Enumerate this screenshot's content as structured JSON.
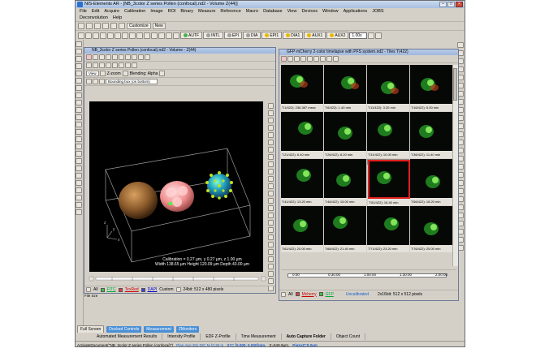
{
  "app": {
    "title": "NIS-Elements AR - [NB_3color Z series Pollen (confocal).nd2 - Volume   Z(44)]"
  },
  "menu": [
    "File",
    "Edit",
    "Acquire",
    "Calibration",
    "Image",
    "ROI",
    "Binary",
    "Measure",
    "Reference",
    "Macro",
    "Database",
    "View",
    "Devices",
    "Window",
    "Applications",
    "JOBS"
  ],
  "menu2": [
    "Deconvolution",
    "Help"
  ],
  "toolbar1": {
    "customize": "Customize",
    "new": "New"
  },
  "toolbar2": {
    "channels": [
      {
        "label": "AUTF",
        "color": "#4caf50"
      },
      {
        "label": "INTL",
        "color": "#9e9e9e"
      },
      {
        "label": "EPI",
        "color": "#9e9e9e"
      },
      {
        "label": "DIA",
        "color": "#9e9e9e"
      },
      {
        "label": "EPI1",
        "color": "#e6b800"
      },
      {
        "label": "DIA1",
        "color": "#e6b800"
      },
      {
        "label": "AUX1",
        "color": "#e6b800"
      },
      {
        "label": "AUX2",
        "color": "#e6b800"
      }
    ],
    "zoom": "1.00x"
  },
  "left_doc": {
    "title": "NB_3color Z series Pollen (confocal).nd2 - Volume - Z(44)",
    "view_label": "View",
    "z_zoom": "Z-zoom",
    "blending_label": "Blending: Alpha",
    "bbox": "Bounding box (on bottom)",
    "calibration_line1": "Calibration = 0.27 µm, y 0.27 µm, z 1.00 µm",
    "calibration_line2": "Width 138.65 µm Height 120.09 µm Depth 43.00 µm",
    "tabs": [
      "All",
      "FITC",
      "TexRed",
      "DAPI",
      "Custom"
    ],
    "info": "24bit: 512 x 480 pixels",
    "filesize": "File Sze"
  },
  "right_doc": {
    "title": "GFP-mCherry 2-color timelapse with PFS system.nd2 - Tiles   T(422)",
    "tiles": [
      "T:1/422): 236.387 msec",
      "T:6/422): 1.40 min",
      "T:11/422): 3.20 min",
      "T:16/422): 5.00 min",
      "T:21/422): 6.40 min",
      "T:26/422): 8.20 min",
      "T:31/422): 10.00 min",
      "T:36/422): 11.40 min",
      "T:41/422): 13.20 min",
      "T:46/422): 15.00 min",
      "T:51/422): 16.40 min",
      "T:56/422): 18.20 min",
      "T:61/422): 20.00 min",
      "T:66/422): 21.40 min",
      "T:71/422): 23.20 min",
      "T:76/422): 25.00 min"
    ],
    "selected_tile": 10,
    "timeline_labels": [
      "0:00",
      "0:30:00",
      "1:00:00",
      "1:30:00",
      "2:00:00"
    ],
    "tabs": [
      "All",
      "Mcherry",
      "GFP"
    ],
    "uncalibrated": "Uncalibrated",
    "info": "2x16bit: 512 x 512 pixels"
  },
  "dock_tabs": [
    "Automated Measurement Results",
    "Intensity Profile",
    "EDF Z-Profile",
    "Time Measurement",
    "Auto Capture Folder",
    "Object Count"
  ],
  "dock_active": "Auto Capture Folder",
  "panel_tabs": [
    "Full Screen",
    "Docked Controls",
    "Measurement",
    "ZMonitors"
  ],
  "status": {
    "doc": "ActivateDocument(\"NB_3color Z series Pollen (confocal)\")",
    "mag": "Plan Apo 20x DIC M (0.30 m",
    "xy": "XY= [0.000, 0.000]mm,",
    "z": "Z=549.9µm,",
    "pz": "PiezoZ=0.0µm"
  },
  "colors": {
    "accent": "#2d6fd0",
    "selection": "#e02020",
    "gfp": "#33dd33"
  }
}
